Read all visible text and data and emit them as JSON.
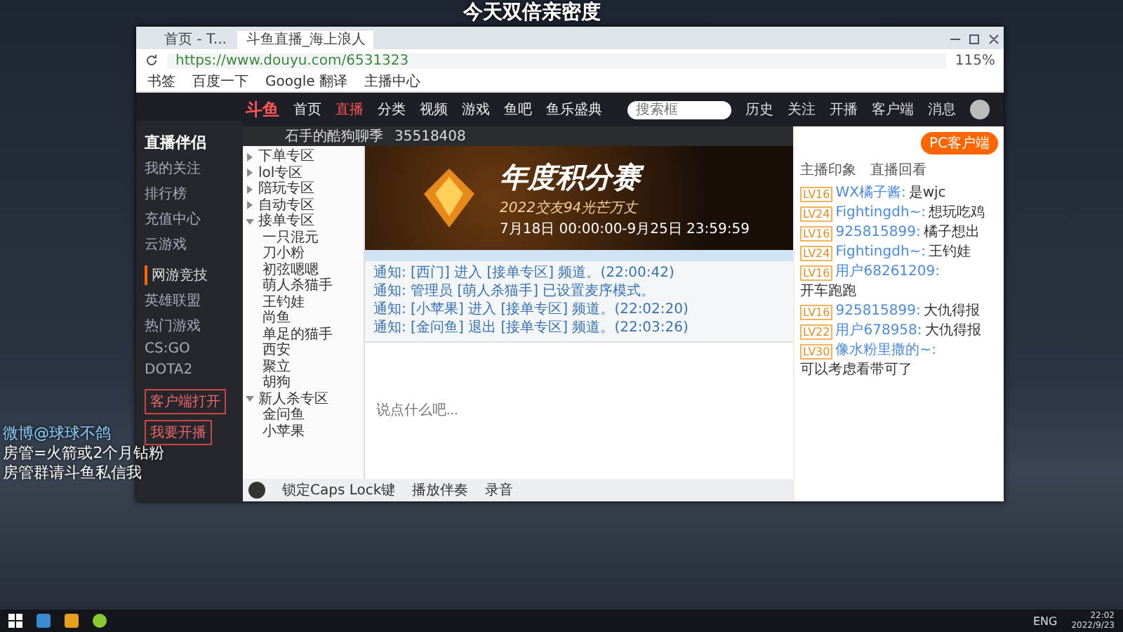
{
  "overlay": {
    "headline": "今天双倍亲密度",
    "lines": [
      "微博@球球不鸽",
      "房管=火箭或2个月钻粉",
      "房管群请斗鱼私信我"
    ]
  },
  "client_panel": {
    "logo": "直播伴侣",
    "menu": [
      {
        "label": "我的关注"
      },
      {
        "label": "排行榜"
      },
      {
        "label": "充值中心"
      },
      {
        "label": "云游戏"
      }
    ],
    "section": "网游竞技",
    "games": [
      "英雄联盟",
      "热门游戏",
      "CS:GO",
      "DOTA2"
    ],
    "buttons": [
      "客户端打开",
      "我要开播"
    ]
  },
  "browser": {
    "tabs": [
      {
        "label": "首页 - T...",
        "selected": false
      },
      {
        "label": "斗鱼直播_海上浪人",
        "selected": true
      }
    ],
    "url": "https://www.douyu.com/6531323",
    "zoom": "115%",
    "bookmarks": [
      "书签",
      "百度一下",
      "Google 翻译",
      "主播中心"
    ]
  },
  "site": {
    "logo": "斗鱼",
    "nav": [
      {
        "label": "首页",
        "selected": false
      },
      {
        "label": "直播",
        "selected": true
      },
      {
        "label": "分类",
        "selected": false
      },
      {
        "label": "视频",
        "selected": false
      },
      {
        "label": "游戏",
        "selected": false
      },
      {
        "label": "鱼吧",
        "selected": false
      },
      {
        "label": "鱼乐盛典",
        "selected": false
      }
    ],
    "search": {
      "placeholder": "搜索框"
    },
    "actions": [
      "历史",
      "关注",
      "开播",
      "客户端",
      "消息"
    ]
  },
  "voice_app": {
    "room": "石手的酷狗聊季",
    "room_id": "35518408",
    "channels": [
      {
        "label": "下单专区",
        "expanded": false
      },
      {
        "label": "lol专区",
        "expanded": false
      },
      {
        "label": "陪玩专区",
        "expanded": false
      },
      {
        "label": "自动专区",
        "expanded": false
      },
      {
        "label": "接单专区",
        "expanded": true,
        "children": [
          {
            "label": "一只混元"
          },
          {
            "label": "刀小粉"
          },
          {
            "label": "初弦嗯嗯"
          },
          {
            "label": "萌人杀猫手"
          },
          {
            "label": "王钓娃"
          },
          {
            "label": "尚鱼"
          },
          {
            "label": "单足的猫手"
          },
          {
            "label": "西安"
          },
          {
            "label": "聚立"
          },
          {
            "label": "胡狗"
          }
        ]
      },
      {
        "label": "新人杀专区",
        "expanded": true,
        "children": [
          {
            "label": "金问鱼"
          },
          {
            "label": "小苹果"
          }
        ]
      }
    ],
    "banner": {
      "title": "年度积分赛",
      "subtitle": "2022交友94光芒万丈",
      "dates": "7月18日 00:00:00-9月25日 23:59:59"
    },
    "messages": [
      "通知: [西门] 进入 [接单专区] 频道。(22:00:42)",
      "通知: 管理员 [萌人杀猫手] 已设置麦序模式。",
      "通知: [小苹果] 进入 [接单专区] 频道。(22:02:20)",
      "通知: [金问鱼] 退出 [接单专区] 频道。(22:03:26)"
    ],
    "input": {
      "placeholder": "说点什么吧..."
    },
    "bottom": [
      "锁定Caps Lock键",
      "播放伴奏",
      "录音"
    ]
  },
  "side_panel": {
    "client_button": "PC客户端",
    "links": [
      "主播印象",
      "直播回看"
    ],
    "chat": [
      {
        "level": "LV16",
        "user": "WX橘子酱:",
        "text": "是wjc"
      },
      {
        "level": "LV24",
        "user": "Fightingdh~:",
        "text": "想玩吃鸡"
      },
      {
        "level": "LV16",
        "user": "925815899:",
        "text": "橘子想出"
      },
      {
        "level": "LV24",
        "user": "Fightingdh~:",
        "text": "王钓娃"
      },
      {
        "level": "LV16",
        "user": "用户68261209:",
        "text": "开车跑跑"
      },
      {
        "level": "LV16",
        "user": "925815899:",
        "text": "大仇得报"
      },
      {
        "level": "LV22",
        "user": "用户678958:",
        "text": "大仇得报"
      },
      {
        "level": "LV30",
        "user": "像水粉里撒的~:",
        "text": "可以考虑看带可了"
      }
    ]
  },
  "taskbar": {
    "language": "ENG",
    "time": "22:02",
    "date": "2022/9/23"
  }
}
